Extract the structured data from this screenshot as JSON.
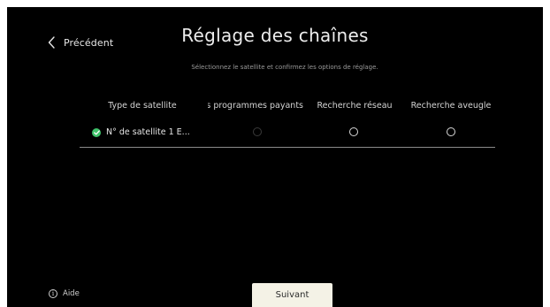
{
  "header": {
    "back_label": "Précédent",
    "title": "Réglage des chaînes",
    "subtitle": "Sélectionnez le satellite et confirmez les options de réglage."
  },
  "table": {
    "columns": [
      "Type de satellite",
      "Recherche des programmes payants",
      "Recherche réseau",
      "Recherche aveugle"
    ],
    "rows": [
      {
        "satellite": "N° de satellite 1 E...",
        "selected": true,
        "pay_programs_search": false,
        "pay_programs_search_enabled": false,
        "network_search": false,
        "blind_search": false
      }
    ]
  },
  "footer": {
    "help_icon_glyph": "i",
    "help_label": "Aide",
    "next_label": "Suivant"
  },
  "colors": {
    "background": "#000000",
    "check_green": "#3fc26a",
    "button_bg": "#f4f2e6",
    "divider": "#8a8a8a"
  },
  "icons": {
    "back": "chevron-left-icon",
    "selected": "check-circle-icon",
    "help": "info-icon"
  }
}
